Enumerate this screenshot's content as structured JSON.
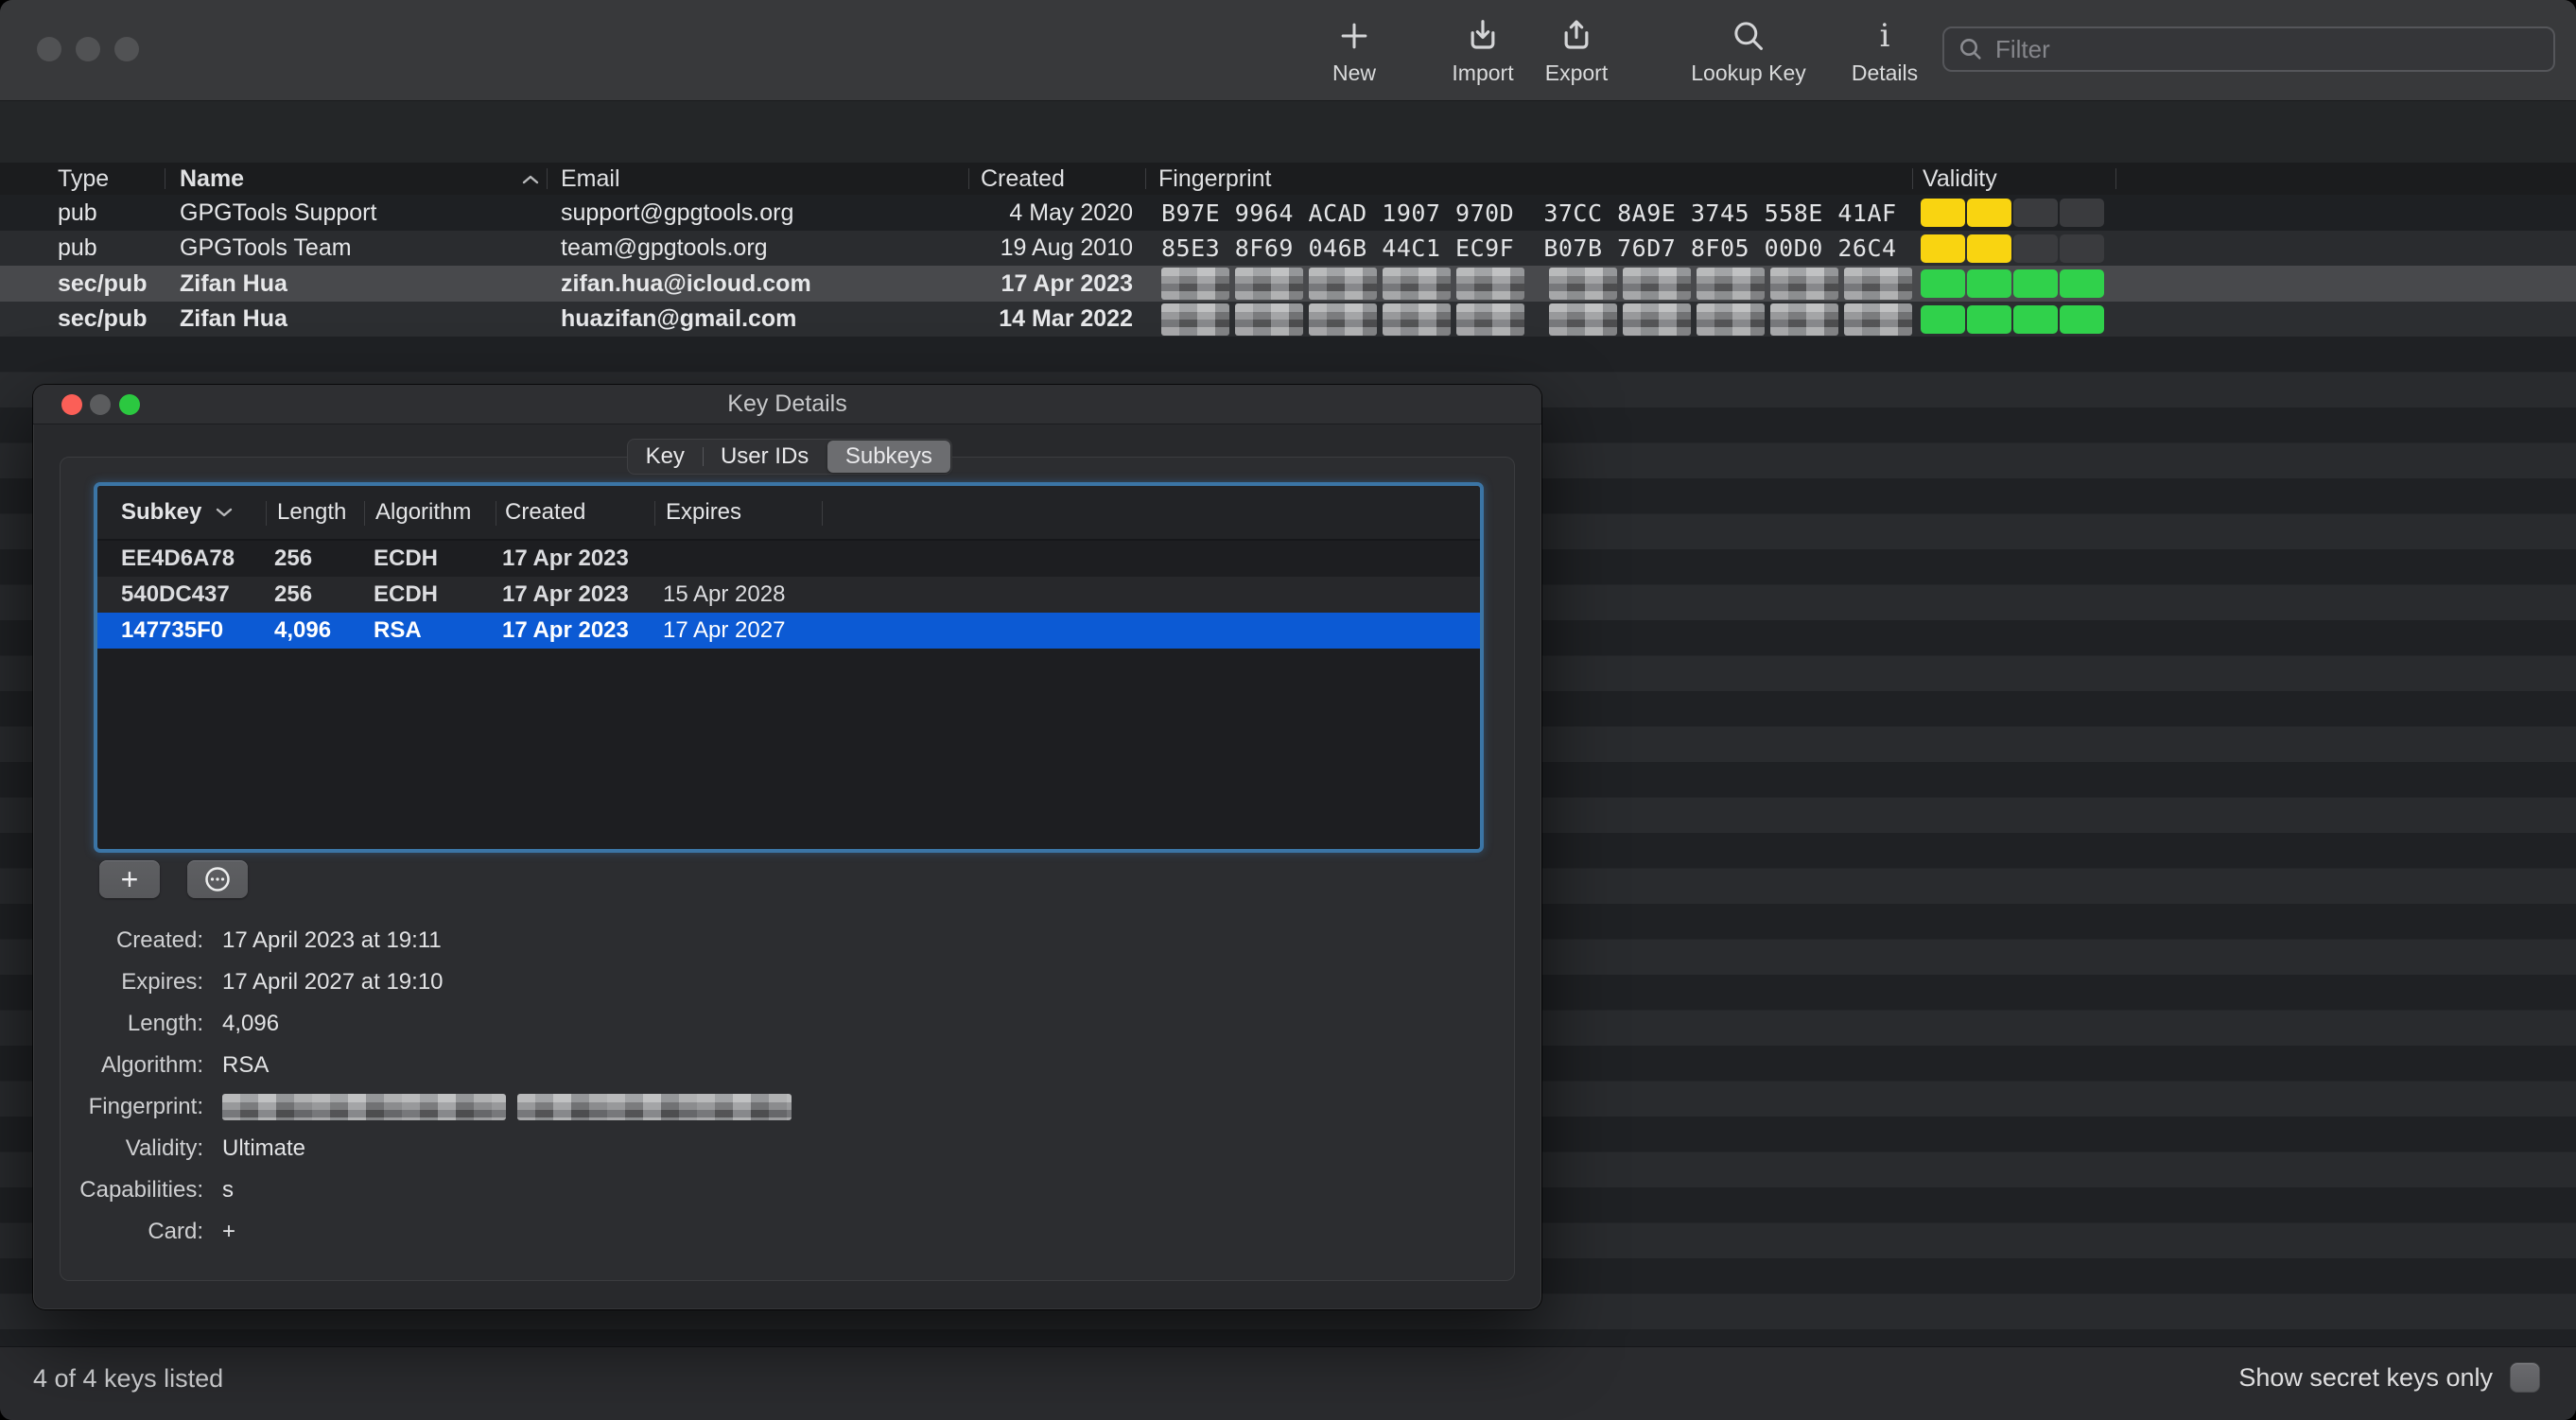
{
  "toolbar": {
    "items": [
      {
        "label": "New",
        "icon": "plus-icon"
      },
      {
        "label": "Import",
        "icon": "tray-arrow-down-icon"
      },
      {
        "label": "Export",
        "icon": "tray-arrow-up-icon"
      },
      {
        "label": "Lookup Key",
        "icon": "magnifier-icon"
      },
      {
        "label": "Details",
        "icon": "info-icon"
      }
    ],
    "filter": {
      "placeholder": "Filter",
      "value": ""
    }
  },
  "main_table": {
    "columns": {
      "type": "Type",
      "name": "Name",
      "email": "Email",
      "created": "Created",
      "fingerprint": "Fingerprint",
      "validity": "Validity"
    },
    "sort_column": "Name",
    "sort_direction": "ascending",
    "rows": [
      {
        "type": "pub",
        "name": "GPGTools Support",
        "email": "support@gpgtools.org",
        "created": "4 May 2020",
        "fingerprint": "B97E 9964 ACAD 1907 970D  37CC 8A9E 3745 558E 41AF",
        "fingerprint_redacted": false,
        "validity_filled": 2,
        "validity_total": 4,
        "validity_color": "yellow",
        "secret": false,
        "selected": false
      },
      {
        "type": "pub",
        "name": "GPGTools Team",
        "email": "team@gpgtools.org",
        "created": "19 Aug 2010",
        "fingerprint": "85E3 8F69 046B 44C1 EC9F  B07B 76D7 8F05 00D0 26C4",
        "fingerprint_redacted": false,
        "validity_filled": 2,
        "validity_total": 4,
        "validity_color": "yellow",
        "secret": false,
        "selected": false
      },
      {
        "type": "sec/pub",
        "name": "Zifan Hua",
        "email": "zifan.hua@icloud.com",
        "created": "17 Apr 2023",
        "fingerprint": "",
        "fingerprint_redacted": true,
        "validity_filled": 4,
        "validity_total": 4,
        "validity_color": "green",
        "secret": true,
        "selected": true
      },
      {
        "type": "sec/pub",
        "name": "Zifan Hua",
        "email": "huazifan@gmail.com",
        "created": "14 Mar 2022",
        "fingerprint": "",
        "fingerprint_redacted": true,
        "validity_filled": 4,
        "validity_total": 4,
        "validity_color": "green",
        "secret": true,
        "selected": false
      }
    ]
  },
  "dialog": {
    "title": "Key Details",
    "tabs": [
      {
        "label": "Key",
        "selected": false
      },
      {
        "label": "User IDs",
        "selected": false
      },
      {
        "label": "Subkeys",
        "selected": true
      }
    ],
    "subkey_table": {
      "columns": {
        "subkey": "Subkey",
        "length": "Length",
        "algorithm": "Algorithm",
        "created": "Created",
        "expires": "Expires"
      },
      "sort_column": "Subkey",
      "sort_direction": "descending",
      "rows": [
        {
          "subkey": "EE4D6A78",
          "length": "256",
          "algorithm": "ECDH",
          "created": "17 Apr 2023",
          "expires": "",
          "selected": false
        },
        {
          "subkey": "540DC437",
          "length": "256",
          "algorithm": "ECDH",
          "created": "17 Apr 2023",
          "expires": "15 Apr 2028",
          "selected": false
        },
        {
          "subkey": "147735F0",
          "length": "4,096",
          "algorithm": "RSA",
          "created": "17 Apr 2023",
          "expires": "17 Apr 2027",
          "selected": true
        }
      ]
    },
    "buttons": {
      "add": "+",
      "actions": "ellipsis-circle"
    },
    "details": {
      "created_label": "Created:",
      "created": "17 April 2023 at 19:11",
      "expires_label": "Expires:",
      "expires": "17 April 2027 at 19:10",
      "length_label": "Length:",
      "length": "4,096",
      "algorithm_label": "Algorithm:",
      "algorithm": "RSA",
      "fingerprint_label": "Fingerprint:",
      "fingerprint_redacted": true,
      "validity_label": "Validity:",
      "validity": "Ultimate",
      "capabilities_label": "Capabilities:",
      "capabilities": "s",
      "card_label": "Card:",
      "card": "+"
    }
  },
  "status_bar": {
    "left_text": "4 of 4 keys listed",
    "right_label": "Show secret keys only",
    "checkbox_checked": false
  },
  "colors": {
    "accent_blue": "#0c5ad4",
    "validity_yellow": "#f9d411",
    "validity_green": "#30d14b",
    "focus_ring": "#3e82ba"
  }
}
